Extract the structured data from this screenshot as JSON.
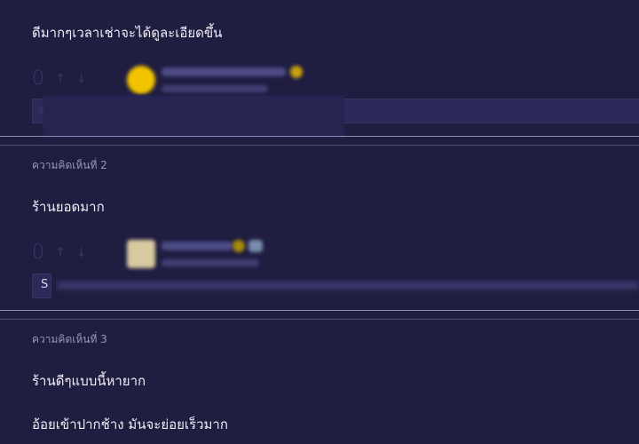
{
  "comment1": {
    "text": "ดีมากๆเวลาเช่าจะได้ดูละเอียดขึ้น",
    "votes": "0"
  },
  "comment2": {
    "label": "ความคิดเห็นที่ 2",
    "text": "ร้านยอดมาก",
    "votes": "0",
    "reply_initial": "S"
  },
  "comment3": {
    "label": "ความคิดเห็นที่ 3",
    "text_line1": "ร้านดีๆแบบนี้หายาก",
    "text_line2": "อ้อยเข้าปากช้าง มันจะย่อยเร็วมาก"
  },
  "colors": {
    "background": "#1f1d40",
    "divider": "#8e8bb0",
    "avatar1": "#f2c400"
  }
}
